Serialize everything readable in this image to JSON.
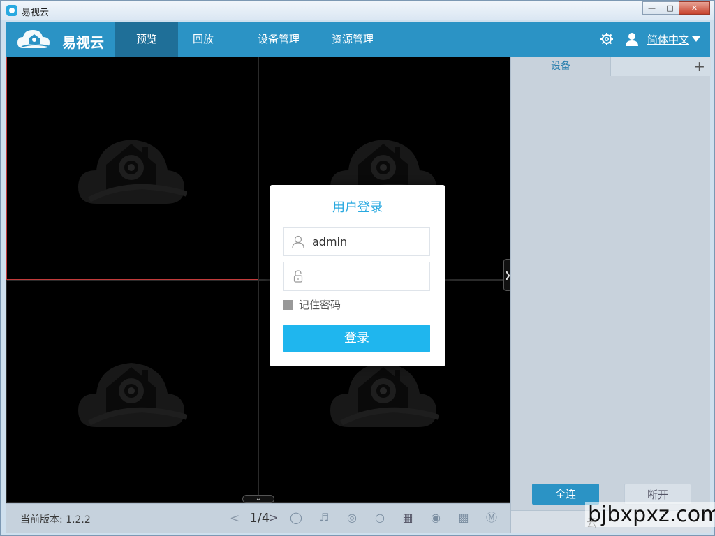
{
  "window": {
    "title": "易视云"
  },
  "navbar": {
    "brand": "易视云",
    "tabs": [
      {
        "label": "预览",
        "active": true
      },
      {
        "label": "回放",
        "active": false
      },
      {
        "label": "设备管理",
        "active": false
      },
      {
        "label": "资源管理",
        "active": false
      }
    ],
    "icons": [
      "gear-icon",
      "user-icon"
    ],
    "language": "简体中文"
  },
  "viewport": {
    "layout": "2x2",
    "selected_cell": 1
  },
  "statusbar": {
    "version_label": "当前版本: 1.2.2",
    "page": "1/4",
    "prev": "<",
    "next": ">"
  },
  "sidepanel": {
    "tab_label": "设备",
    "add_label": "+",
    "connect_all": "全连",
    "disconnect": "断开",
    "footer_label": "云"
  },
  "login_dialog": {
    "title": "用户登录",
    "username_value": "admin",
    "password_value": "",
    "remember_label": "记住密码",
    "remember_checked": true,
    "submit_label": "登录"
  },
  "watermark": "bjbxpxz.com",
  "colors": {
    "accent": "#2b93c5",
    "login_button": "#1fb6ee",
    "selected_border": "#c23b3b"
  }
}
